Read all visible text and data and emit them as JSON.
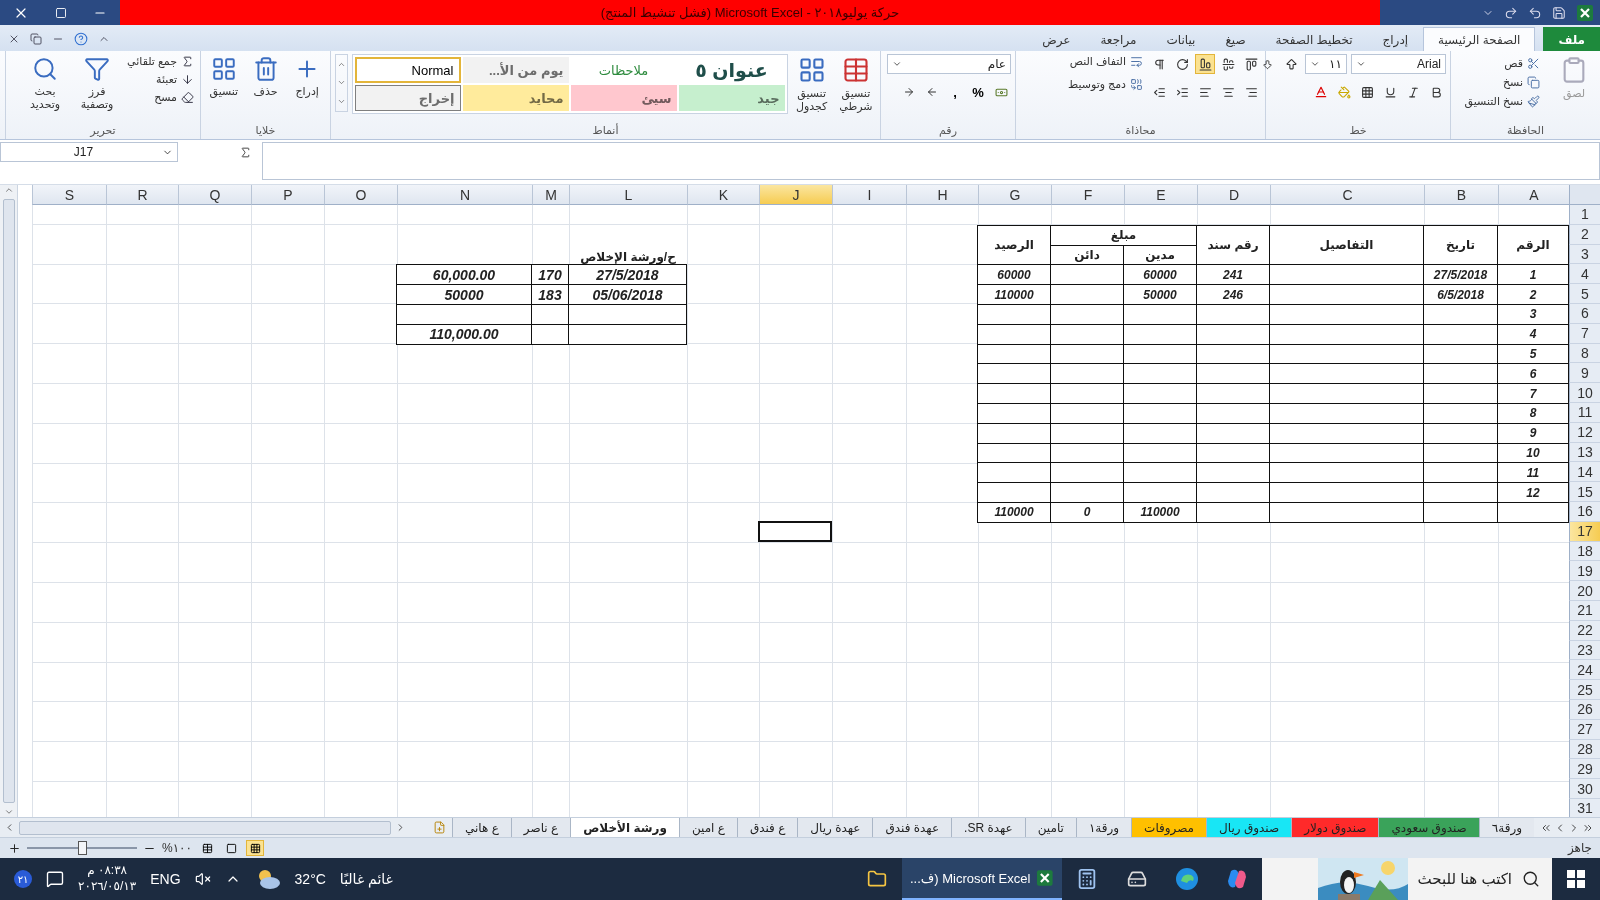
{
  "window": {
    "title": "حركة يوليو٢٠١٨ - Microsoft Excel (فشل تنشيط المنتج)"
  },
  "ribbon_tabs": [
    {
      "label": "ملف",
      "kind": "file",
      "selected": false
    },
    {
      "label": "الصفحة الرئيسية",
      "kind": "tab",
      "selected": true
    },
    {
      "label": "إدراج",
      "kind": "tab",
      "selected": false
    },
    {
      "label": "تخطيط الصفحة",
      "kind": "tab",
      "selected": false
    },
    {
      "label": "صيغ",
      "kind": "tab",
      "selected": false
    },
    {
      "label": "بيانات",
      "kind": "tab",
      "selected": false
    },
    {
      "label": "مراجعة",
      "kind": "tab",
      "selected": false
    },
    {
      "label": "عرض",
      "kind": "tab",
      "selected": false
    }
  ],
  "ribbon": {
    "clipboard": {
      "label": "الحافظة",
      "paste": {
        "label": "لصق",
        "disabled": true
      },
      "items": [
        "قص",
        "نسخ",
        "نسخ التنسيق"
      ]
    },
    "font": {
      "label": "خط",
      "font_name": "Arial",
      "font_size": "١١"
    },
    "alignment": {
      "label": "محاذاة",
      "vertical": [
        {
          "selected": false
        },
        {
          "selected": false
        },
        {
          "selected": true
        }
      ],
      "wrap": "التفاف النص",
      "merge": "دمج وتوسيط"
    },
    "number": {
      "label": "رقم",
      "format": "عام",
      "glyphs": [
        "%",
        ","
      ]
    },
    "styles": {
      "label": "أنماط",
      "conditional": "تنسيق شرطي",
      "as_table": "تنسيق كجدول",
      "cell_styles": [
        {
          "label": "عنوان ٥",
          "kind": "heading",
          "color": "#ffffff",
          "selected": false
        },
        {
          "label": "ملاحظات",
          "kind": "note",
          "color": "#ffffff",
          "selected": false
        },
        {
          "label": "يوم من الأ...",
          "kind": "plain",
          "color": "#f2f2f2",
          "selected": false
        },
        {
          "label": "Normal",
          "kind": "plain",
          "color": "#ffffff",
          "selected": true
        },
        {
          "label": "جيد",
          "kind": "plain",
          "color": "#c6efce",
          "selected": false
        },
        {
          "label": "سيئ",
          "kind": "plain",
          "color": "#ffc7ce",
          "selected": false
        },
        {
          "label": "محايد",
          "kind": "plain",
          "color": "#ffeb9c",
          "selected": false
        },
        {
          "label": "إخراج",
          "kind": "boxed",
          "color": "#f2f2f2",
          "selected": false
        }
      ]
    },
    "cells": {
      "label": "خلايا",
      "items": [
        "إدراج",
        "حذف",
        "تنسيق"
      ]
    },
    "editing": {
      "label": "تحرير",
      "small": [
        "جمع تلقائي",
        "تعبئة",
        "مسح"
      ],
      "large": [
        "فرز وتصفية",
        "بحث وتحديد"
      ]
    }
  },
  "name_box": "J17",
  "columns": [
    {
      "label": "A",
      "selected": false
    },
    {
      "label": "B",
      "selected": false
    },
    {
      "label": "C",
      "selected": false
    },
    {
      "label": "D",
      "selected": false
    },
    {
      "label": "E",
      "selected": false
    },
    {
      "label": "F",
      "selected": false
    },
    {
      "label": "G",
      "selected": false
    },
    {
      "label": "H",
      "selected": false
    },
    {
      "label": "I",
      "selected": false
    },
    {
      "label": "J",
      "selected": true
    },
    {
      "label": "K",
      "selected": false
    },
    {
      "label": "L",
      "selected": false
    },
    {
      "label": "M",
      "selected": false
    },
    {
      "label": "N",
      "selected": false
    },
    {
      "label": "O",
      "selected": false
    },
    {
      "label": "P",
      "selected": false
    },
    {
      "label": "Q",
      "selected": false
    },
    {
      "label": "R",
      "selected": false
    },
    {
      "label": "S",
      "selected": false
    }
  ],
  "row_headers": [
    {
      "label": "1",
      "selected": false
    },
    {
      "label": "2",
      "selected": false
    },
    {
      "label": "3",
      "selected": false
    },
    {
      "label": "4",
      "selected": false
    },
    {
      "label": "5",
      "selected": false
    },
    {
      "label": "6",
      "selected": false
    },
    {
      "label": "7",
      "selected": false
    },
    {
      "label": "8",
      "selected": false
    },
    {
      "label": "9",
      "selected": false
    },
    {
      "label": "10",
      "selected": false
    },
    {
      "label": "11",
      "selected": false
    },
    {
      "label": "12",
      "selected": false
    },
    {
      "label": "13",
      "selected": false
    },
    {
      "label": "14",
      "selected": false
    },
    {
      "label": "15",
      "selected": false
    },
    {
      "label": "16",
      "selected": false
    },
    {
      "label": "17",
      "selected": true
    },
    {
      "label": "18",
      "selected": false
    },
    {
      "label": "19",
      "selected": false
    },
    {
      "label": "20",
      "selected": false
    },
    {
      "label": "21",
      "selected": false
    },
    {
      "label": "22",
      "selected": false
    },
    {
      "label": "23",
      "selected": false
    },
    {
      "label": "24",
      "selected": false
    },
    {
      "label": "25",
      "selected": false
    },
    {
      "label": "26",
      "selected": false
    },
    {
      "label": "27",
      "selected": false
    },
    {
      "label": "28",
      "selected": false
    },
    {
      "label": "29",
      "selected": false
    },
    {
      "label": "30",
      "selected": false
    },
    {
      "label": "31",
      "selected": false
    }
  ],
  "ledger": {
    "headers": {
      "number": "الرقم",
      "date": "تاريخ",
      "details": "التفاصيل",
      "voucher": "رقم سند",
      "amount": "مبلغ",
      "debit": "مدين",
      "credit": "دائن",
      "balance": "الرصيد"
    },
    "rows": [
      {
        "number": "1",
        "date": "27/5/2018",
        "voucher": "241",
        "debit": "60000",
        "balance": "60000"
      },
      {
        "number": "2",
        "date": "6/5/2018",
        "voucher": "246",
        "debit": "50000",
        "balance": "110000"
      },
      {
        "number": "3"
      },
      {
        "number": "4"
      },
      {
        "number": "5"
      },
      {
        "number": "6"
      },
      {
        "number": "7"
      },
      {
        "number": "8"
      },
      {
        "number": "9"
      },
      {
        "number": "10"
      },
      {
        "number": "11"
      },
      {
        "number": "12"
      }
    ],
    "totals": {
      "debit": "110000",
      "credit": "0",
      "balance": "110000"
    }
  },
  "workshop": {
    "title": "ح/ورشة الإخلاص",
    "rows": [
      {
        "date": "27/5/2018",
        "ref": "170",
        "amount": "60,000.00"
      },
      {
        "date": "05/06/2018",
        "ref": "183",
        "amount": "50000"
      }
    ],
    "total": "110,000.00"
  },
  "sheet_tabs": [
    {
      "label": "ورقة٦",
      "selected": false
    },
    {
      "label": "صندوق سعودي",
      "color": "#3aa35a",
      "selected": false
    },
    {
      "label": "صندوق دولار",
      "color": "#ff2a2a",
      "selected": false
    },
    {
      "label": "صندوق ريال",
      "color": "#18e6f5",
      "selected": false
    },
    {
      "label": "مصروفات",
      "color": "#ffc000",
      "selected": false
    },
    {
      "label": "ورقة١",
      "selected": false
    },
    {
      "label": "تامين",
      "selected": false
    },
    {
      "label": "عهدة SR.",
      "selected": false
    },
    {
      "label": "عهدة فندق",
      "selected": false
    },
    {
      "label": "عهدة ريال",
      "selected": false
    },
    {
      "label": "ع فندق",
      "selected": false
    },
    {
      "label": "ع امين",
      "selected": false
    },
    {
      "label": "ورشة الأخلاص",
      "selected": true
    },
    {
      "label": "ع ناصر",
      "selected": false
    },
    {
      "label": "ع هاني",
      "selected": false
    }
  ],
  "status_bar": {
    "status": "جاهز",
    "zoom": "%١٠٠",
    "zoom_slider": {
      "level": 0.5
    }
  },
  "taskbar": {
    "search_placeholder": "اكتب هنا للبحث",
    "app": "Microsoft Excel (ف...",
    "weather": {
      "temperature": "32°C",
      "condition": "غائم غالبًا"
    },
    "language": "ENG",
    "time": "٠٨:٣٨ م",
    "date": "٢٠٢٦/٠٥/١٣",
    "notifications": "٢١"
  }
}
